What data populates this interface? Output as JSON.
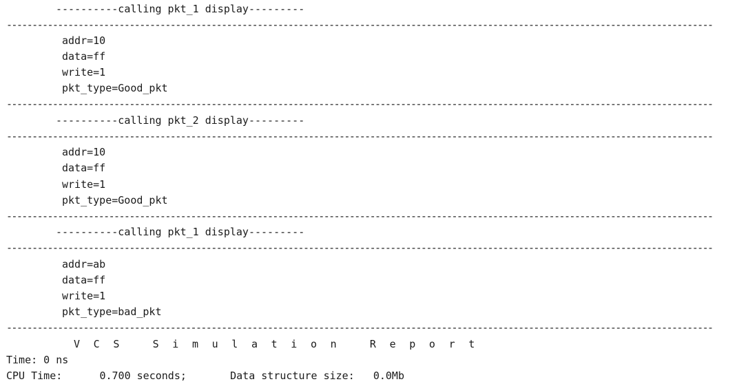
{
  "console": {
    "separator": "------------------------------------------------------------------------------------------------------------------------------------------",
    "blocks": [
      {
        "header": "----------calling pkt_1 display---------",
        "fields": [
          "addr=10",
          "data=ff",
          "write=1",
          "pkt_type=Good_pkt"
        ]
      },
      {
        "header": "----------calling pkt_2 display---------",
        "fields": [
          "addr=10",
          "data=ff",
          "write=1",
          "pkt_type=Good_pkt"
        ]
      },
      {
        "header": "----------calling pkt_1 display---------",
        "fields": [
          "addr=ab",
          "data=ff",
          "write=1",
          "pkt_type=bad_pkt"
        ]
      }
    ],
    "report": {
      "title": "V C S   S i m u l a t i o n   R e p o r t",
      "time_line": "Time: 0 ns",
      "cpu_line": "CPU Time:      0.700 seconds;       Data structure size:   0.0Mb"
    }
  }
}
